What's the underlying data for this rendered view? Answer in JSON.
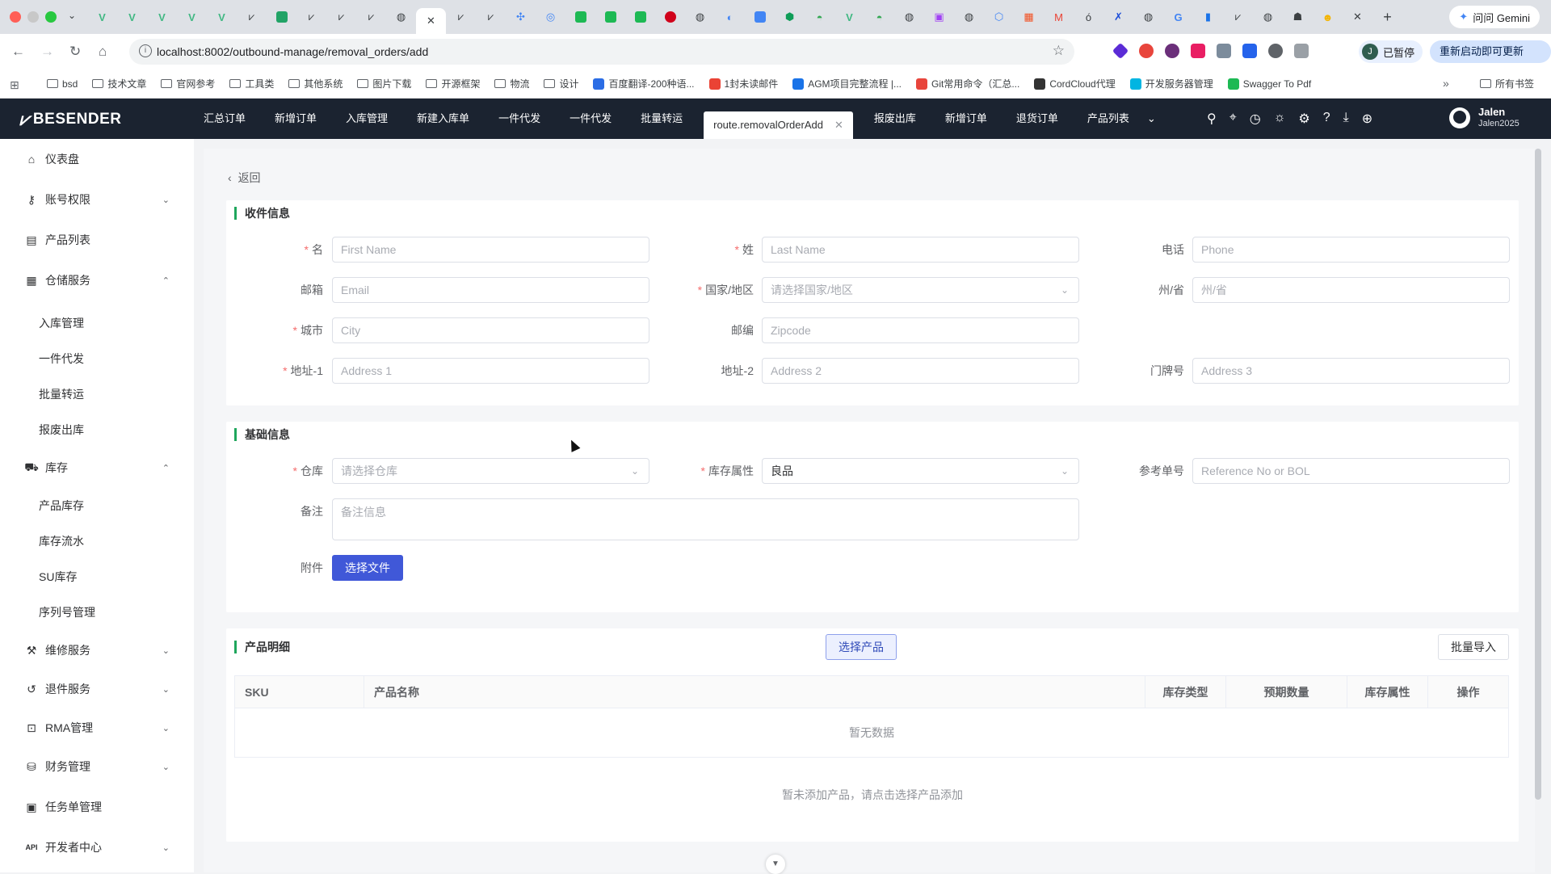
{
  "browser": {
    "url": "localhost:8002/outbound-manage/removal_orders/add",
    "gemini_label": "问问 Gemini",
    "pause_label": "已暂停",
    "pause_avatar": "J",
    "update_label": "重新启动即可更新",
    "bookmarks": [
      "bsd",
      "技术文章",
      "官网参考",
      "工具类",
      "其他系统",
      "图片下载",
      "开源框架",
      "物流",
      "设计",
      "百度翻译-200种语...",
      "1封未读邮件",
      "AGM项目完整流程 |...",
      "Git常用命令（汇总...",
      "CordCloud代理",
      "开发服务器管理",
      "Swagger To Pdf"
    ],
    "bookmarks_all": "所有书签"
  },
  "app": {
    "logo": "BESENDER",
    "nav": [
      "汇总订单",
      "新增订单",
      "入库管理",
      "新建入库单",
      "一件代发",
      "一件代发",
      "批量转运"
    ],
    "active_tab": "route.removalOrderAdd",
    "nav_after": [
      "报废出库",
      "新增订单",
      "退货订单",
      "产品列表"
    ],
    "user_name": "Jalen",
    "user_id": "Jalen2025"
  },
  "sidebar": {
    "items": [
      {
        "label": "仪表盘",
        "icon": "home-icon"
      },
      {
        "label": "账号权限",
        "icon": "key-icon"
      },
      {
        "label": "产品列表",
        "icon": "list-icon"
      },
      {
        "label": "仓储服务",
        "icon": "warehouse-icon"
      },
      {
        "label": "入库管理"
      },
      {
        "label": "一件代发"
      },
      {
        "label": "批量转运"
      },
      {
        "label": "报废出库"
      },
      {
        "label": "库存",
        "icon": "inventory-icon"
      },
      {
        "label": "产品库存"
      },
      {
        "label": "库存流水"
      },
      {
        "label": "SU库存"
      },
      {
        "label": "序列号管理"
      },
      {
        "label": "维修服务",
        "icon": "wrench-icon"
      },
      {
        "label": "退件服务",
        "icon": "return-icon"
      },
      {
        "label": "RMA管理",
        "icon": "lock-icon"
      },
      {
        "label": "财务管理",
        "icon": "finance-icon"
      },
      {
        "label": "任务单管理",
        "icon": "task-icon"
      },
      {
        "label": "开发者中心",
        "icon": "api-icon"
      }
    ],
    "api_badge": "API"
  },
  "page": {
    "back": "返回",
    "recipient": {
      "title": "收件信息",
      "first_name": {
        "label": "名",
        "placeholder": "First Name"
      },
      "last_name": {
        "label": "姓",
        "placeholder": "Last Name"
      },
      "phone": {
        "label": "电话",
        "placeholder": "Phone"
      },
      "email": {
        "label": "邮箱",
        "placeholder": "Email"
      },
      "country": {
        "label": "国家/地区",
        "placeholder": "请选择国家/地区"
      },
      "state": {
        "label": "州/省",
        "placeholder": "州/省"
      },
      "city": {
        "label": "城市",
        "placeholder": "City"
      },
      "zipcode": {
        "label": "邮编",
        "placeholder": "Zipcode"
      },
      "address1": {
        "label": "地址-1",
        "placeholder": "Address 1"
      },
      "address2": {
        "label": "地址-2",
        "placeholder": "Address 2"
      },
      "address3": {
        "label": "门牌号",
        "placeholder": "Address 3"
      }
    },
    "basic": {
      "title": "基础信息",
      "warehouse": {
        "label": "仓库",
        "placeholder": "请选择仓库"
      },
      "stock_attr": {
        "label": "库存属性",
        "value": "良品"
      },
      "reference": {
        "label": "参考单号",
        "placeholder": "Reference No or BOL"
      },
      "remark": {
        "label": "备注",
        "placeholder": "备注信息"
      },
      "attachment": {
        "label": "附件",
        "button": "选择文件"
      }
    },
    "products": {
      "title": "产品明细",
      "select_button": "选择产品",
      "import_button": "批量导入",
      "columns": [
        "SKU",
        "产品名称",
        "库存类型",
        "预期数量",
        "库存属性",
        "操作"
      ],
      "empty": "暂无数据",
      "tip": "暂未添加产品，请点击选择产品添加"
    }
  }
}
